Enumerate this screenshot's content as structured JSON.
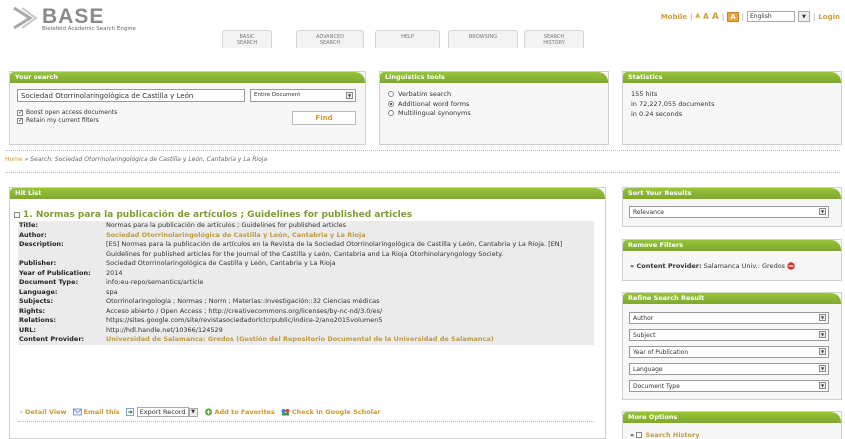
{
  "header": {
    "logo_text": "BASE",
    "logo_subtitle": "Bielefeld Academic Search Engine",
    "tabs": [
      {
        "line1": "BASIC",
        "line2": "SEARCH"
      },
      {
        "line1": "ADVANCED",
        "line2": "SEARCH"
      },
      {
        "line1": "HELP",
        "line2": ""
      },
      {
        "line1": "BROWSING",
        "line2": ""
      },
      {
        "line1": "SEARCH",
        "line2": "HISTORY"
      }
    ],
    "toplinks": {
      "mobile": "Mobile",
      "sep": "|",
      "a_small": "A",
      "a_medium": "A",
      "a_large": "A",
      "a_boxed": "A",
      "language": "English",
      "login": "Login"
    }
  },
  "search_panel": {
    "title": "Your search",
    "query": "Sociedad Otorrinolaringológica de Castilla y León",
    "scope": "Entire Document",
    "boost_label": "Boost open access documents",
    "retain_label": "Retain my current filters",
    "find_label": "Find"
  },
  "linguistics_panel": {
    "title": "Linguistics tools",
    "options": [
      "Verbatim search",
      "Additional word forms",
      "Multilingual synonyms"
    ],
    "selected_index": 1
  },
  "statistics_panel": {
    "title": "Statistics",
    "hits": "155 hits",
    "documents": "in 72,227,055 documents",
    "time": "in 0.24 seconds"
  },
  "breadcrumb": {
    "home": "Home",
    "separator": " » ",
    "search_text": "Search: Sociedad Otorrinolaringológica de Castilla y León, Cantabria y La Rioja"
  },
  "hitlist": {
    "title": "Hit List",
    "record": {
      "heading": "1. Normas para la publicación de artículos ; Guidelines for published articles",
      "fields": [
        {
          "label": "Title:",
          "value": "Normas para la publicación de artículos ; Guidelines for published articles",
          "style": ""
        },
        {
          "label": "Author:",
          "value": "Sociedad Otorrinolaringológica de Castilla y León, Cantabria y La Rioja",
          "style": "green"
        },
        {
          "label": "Description:",
          "value": "[ES] Normas para la publicación de artículos en la Revista de la Sociedad Otorrinolaringológica de Castilla y León, Cantabria y La Rioja. [EN] Guidelines for published articles for the Journal of the Castilla y León, Cantabria and La Rioja Otorhinolaryngology Society.",
          "style": ""
        },
        {
          "label": "Publisher:",
          "value": "Sociedad Otorrinolaringológica de Castilla y León, Cantabria y La Rioja",
          "style": ""
        },
        {
          "label": "Year of Publication:",
          "value": "2014",
          "style": ""
        },
        {
          "label": "Document Type:",
          "value": "info:eu-repo/semantics/article",
          "style": ""
        },
        {
          "label": "Language:",
          "value": "spa",
          "style": ""
        },
        {
          "label": "Subjects:",
          "value": "Otorrinolaringología ; Normas ; Norm ; Materias::Investigación::32 Ciencias médicas",
          "style": ""
        },
        {
          "label": "Rights:",
          "value": "Acceso abierto / Open Access ; http://creativecommons.org/licenses/by-nc-nd/3.0/es/",
          "style": ""
        },
        {
          "label": "Relations:",
          "value": "https://sites.google.com/site/revistasociedadorlclcrpublic/indice-2/ano2015volumen5",
          "style": ""
        },
        {
          "label": "URL:",
          "value": "http://hdl.handle.net/10366/124529",
          "style": ""
        },
        {
          "label": "Content Provider:",
          "value": "Universidad de Salamanca: Gredos (Gestión del Repositorio Documental de la Universidad de Salamanca)",
          "style": "green"
        }
      ],
      "actions": {
        "detail_view": "Detail View",
        "email_this": "Email this",
        "export_record": "Export Record",
        "add_favorites": "Add to Favorites",
        "check_scholar": "Check in Google Scholar"
      }
    }
  },
  "sidebar": {
    "sort": {
      "title": "Sort Your Results",
      "value": "Relevance"
    },
    "remove_filters": {
      "title": "Remove Filters",
      "filter_label": "Content Provider:",
      "filter_value": "Salamanca Univ.: Gredos"
    },
    "refine": {
      "title": "Refine Search Result",
      "options": [
        "Author",
        "Subject",
        "Year of Publication",
        "Language",
        "Document Type"
      ]
    },
    "more_options": {
      "title": "More Options",
      "item": "Search History"
    }
  },
  "colors": {
    "accent_green": "#8cbc34",
    "gold_link": "#c09b3a",
    "remove_red": "#d9342b"
  }
}
